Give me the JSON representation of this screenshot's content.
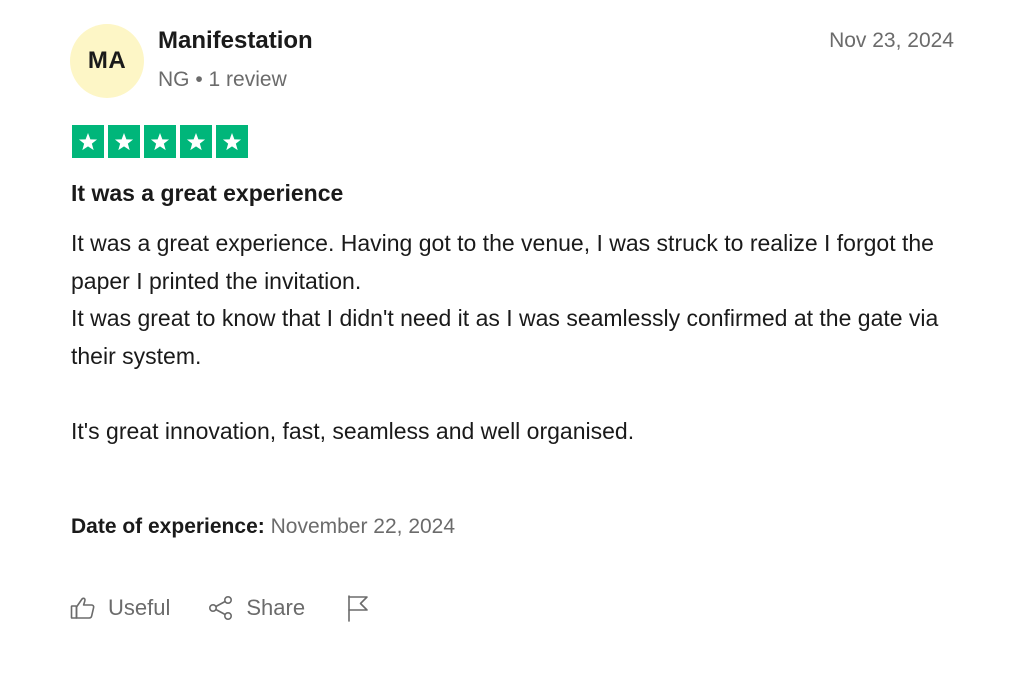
{
  "reviewer": {
    "initials": "MA",
    "name": "Manifestation",
    "country": "NG",
    "separator": "•",
    "review_count": "1 review"
  },
  "review": {
    "date": "Nov 23, 2024",
    "rating": 5,
    "rating_color": "#00b67a",
    "title": "It was a great experience",
    "body_lines": [
      "It was a great experience. Having got to the venue, I was struck to realize I forgot the paper I printed the invitation.",
      "It was great to know that I didn't need it as I was seamlessly confirmed at the gate via their system.",
      "",
      "It's great innovation, fast, seamless and well organised."
    ],
    "experience_label": "Date of experience:",
    "experience_date": "November 22, 2024"
  },
  "actions": {
    "useful_label": "Useful",
    "useful_icon": "thumbs-up-icon",
    "share_label": "Share",
    "share_icon": "share-icon",
    "flag_icon": "flag-icon"
  },
  "colors": {
    "avatar_bg": "#fdf6c6",
    "muted_text": "#6b6b6b",
    "text": "#1a1a1a"
  }
}
